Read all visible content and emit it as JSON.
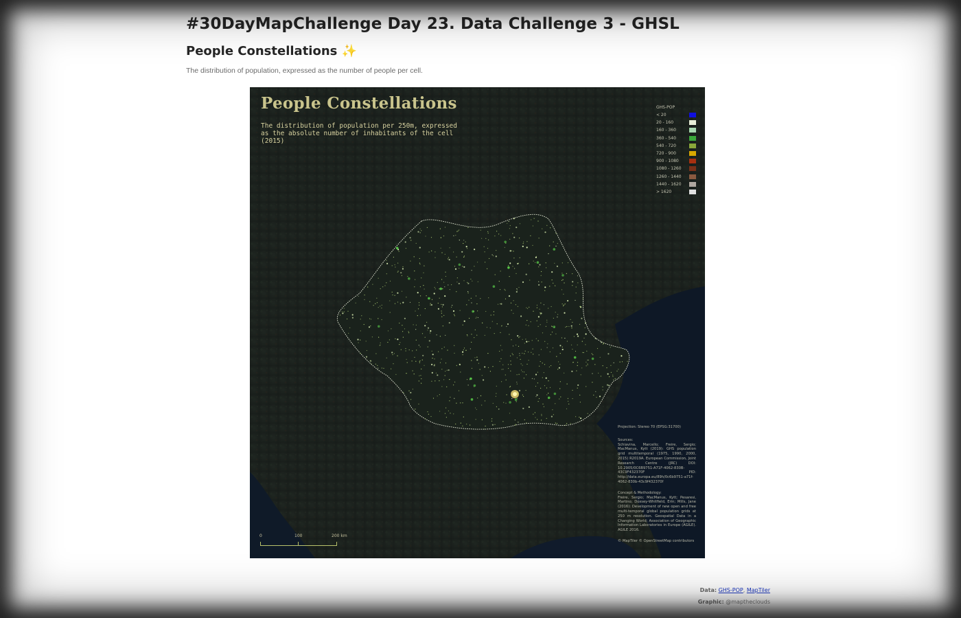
{
  "header": {
    "title": "#30DayMapChallenge Day 23. Data Challenge 3 - GHSL",
    "subtitle": "People Constellations",
    "subtitle_icon": "sparkles",
    "description": "The distribution of population, expressed as the number of people per cell."
  },
  "map": {
    "title": "People Constellations",
    "description": "The distribution of population per 250m, expressed as the absolute number of inhabitants of the cell (2015)",
    "legend": {
      "title": "GHS-POP",
      "items": [
        {
          "label": "< 20",
          "color": "#1010e0"
        },
        {
          "label": "20 - 160",
          "color": "#e8eed8"
        },
        {
          "label": "160 - 360",
          "color": "#a8d8b0"
        },
        {
          "label": "360 - 540",
          "color": "#3aa83a"
        },
        {
          "label": "540 - 720",
          "color": "#8aa83a"
        },
        {
          "label": "720 - 900",
          "color": "#d8a800"
        },
        {
          "label": "900 - 1080",
          "color": "#a83010"
        },
        {
          "label": "1080 - 1260",
          "color": "#7a3018"
        },
        {
          "label": "1260 - 1440",
          "color": "#8a5a40"
        },
        {
          "label": "1440 - 1620",
          "color": "#b0a8a0"
        },
        {
          "label": "> 1620",
          "color": "#e0e0e0"
        }
      ]
    },
    "projection": "Projection: Stereo 70 (EPSG:31700)",
    "credits": [
      {
        "label": "Sources:",
        "text": "Schiavina, Marcello; Freire, Sergio; MacManus, Kytt (2019): GHS population grid multitemporal (1975, 1990, 2000, 2015) R2019A. European Commission, Joint Research Centre (JRC) DOI: 10.2905/0C6B9751-A71F-4062-830B-43C9F432370F PID: http://data.europa.eu/89h/0c6b9751-a71f-4062-830b-43c9f432370f"
      },
      {
        "label": "Concept & Methodology:",
        "text": "Freire, Sergio; MacManus, Kytt; Pesaresi, Martino; Doxsey-Whitfield, Erin; Mills, Jane (2016): Development of new open and free multi-temporal global population grids at 250 m resolution. Geospatial Data in a Changing World; Association of Geographic Information Laboratories in Europe (AGILE). AGILE 2016."
      }
    ],
    "attribution": "© MapTiler © OpenStreetMap contributors",
    "scale": {
      "labels": [
        "0",
        "100",
        "200 km"
      ]
    }
  },
  "footer": {
    "data_label": "Data:",
    "data_links": [
      "GHS-POP",
      "MapTiler"
    ],
    "separator": ",",
    "graphic_label": "Graphic:",
    "graphic_author": "@mapthe​clouds"
  },
  "colors": {
    "map_background": "#1b211d",
    "sea": "#0f1a2a",
    "dots": "#c8e890",
    "border": "#e8ecd8",
    "title": "#c9c48c"
  }
}
